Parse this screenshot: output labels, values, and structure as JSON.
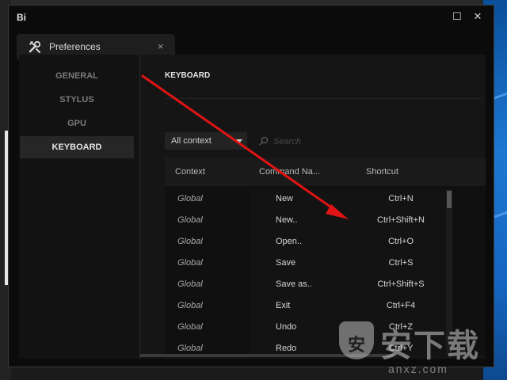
{
  "app": {
    "logo": "Bi"
  },
  "window_controls": {
    "maximize": "☐",
    "close": "✕"
  },
  "tab": {
    "title": "Preferences",
    "close": "×"
  },
  "sidebar": {
    "items": [
      {
        "label": "GENERAL"
      },
      {
        "label": "STYLUS"
      },
      {
        "label": "GPU"
      },
      {
        "label": "KEYBOARD",
        "active": true
      }
    ]
  },
  "panel": {
    "title": "KEYBOARD",
    "context_select": {
      "value": "All context"
    },
    "search": {
      "placeholder": "Search"
    },
    "table": {
      "headers": [
        "Context",
        "Command Na...",
        "Shortcut"
      ],
      "rows": [
        {
          "context": "Global",
          "command": "New",
          "shortcut": "Ctrl+N"
        },
        {
          "context": "Global",
          "command": "New..",
          "shortcut": "Ctrl+Shift+N"
        },
        {
          "context": "Global",
          "command": "Open..",
          "shortcut": "Ctrl+O"
        },
        {
          "context": "Global",
          "command": "Save",
          "shortcut": "Ctrl+S"
        },
        {
          "context": "Global",
          "command": "Save as..",
          "shortcut": "Ctrl+Shift+S"
        },
        {
          "context": "Global",
          "command": "Exit",
          "shortcut": "Ctrl+F4"
        },
        {
          "context": "Global",
          "command": "Undo",
          "shortcut": "Ctrl+Z"
        },
        {
          "context": "Global",
          "command": "Redo",
          "shortcut": "Ctrl+Y"
        }
      ]
    }
  },
  "annotation": {
    "color": "#e01414"
  },
  "watermark": {
    "text": "安下载",
    "shield": "安",
    "url": "anxz.com"
  },
  "colors": {
    "accent": "#e01414",
    "window_bg": "#0b0b0b",
    "active_item": "#262626"
  }
}
